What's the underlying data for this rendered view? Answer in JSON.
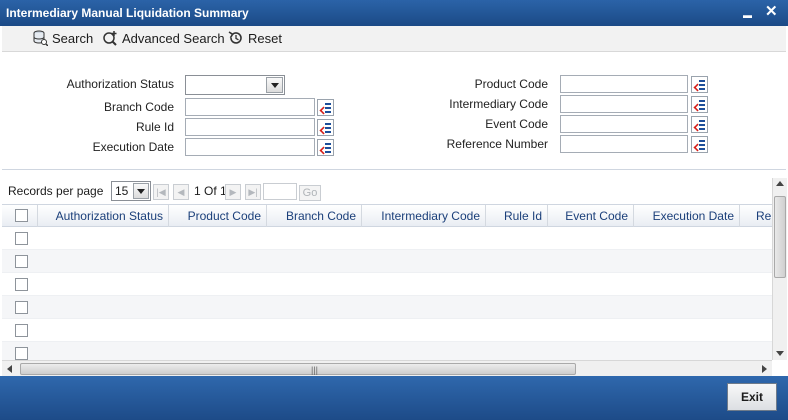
{
  "window": {
    "title": "Intermediary Manual Liquidation Summary",
    "minimize_glyph": "▬",
    "close_glyph": "✕"
  },
  "toolbar": {
    "search": "Search",
    "advanced_search": "Advanced Search",
    "reset": "Reset"
  },
  "criteria": {
    "authorization_status": "Authorization Status",
    "branch_code": "Branch Code",
    "rule_id": "Rule Id",
    "execution_date": "Execution Date",
    "product_code": "Product Code",
    "intermediary_code": "Intermediary Code",
    "event_code": "Event Code",
    "reference_number": "Reference Number"
  },
  "pager": {
    "records_per_page": "Records per page",
    "page_size": "15",
    "page_of": "1 Of 1",
    "go": "Go"
  },
  "grid": {
    "columns": [
      "Authorization Status",
      "Product Code",
      "Branch Code",
      "Intermediary Code",
      "Rule Id",
      "Event Code",
      "Execution Date",
      "Re"
    ],
    "row_count": 6
  },
  "footer": {
    "exit": "Exit"
  },
  "colors": {
    "titlebar": "#1b4a86",
    "header_text": "#1b3f7a",
    "lov_arrow": "#d8201a"
  },
  "icons": [
    "search-icon",
    "advanced-search-icon",
    "reset-icon",
    "lov-icon",
    "minimize-icon",
    "close-icon"
  ]
}
